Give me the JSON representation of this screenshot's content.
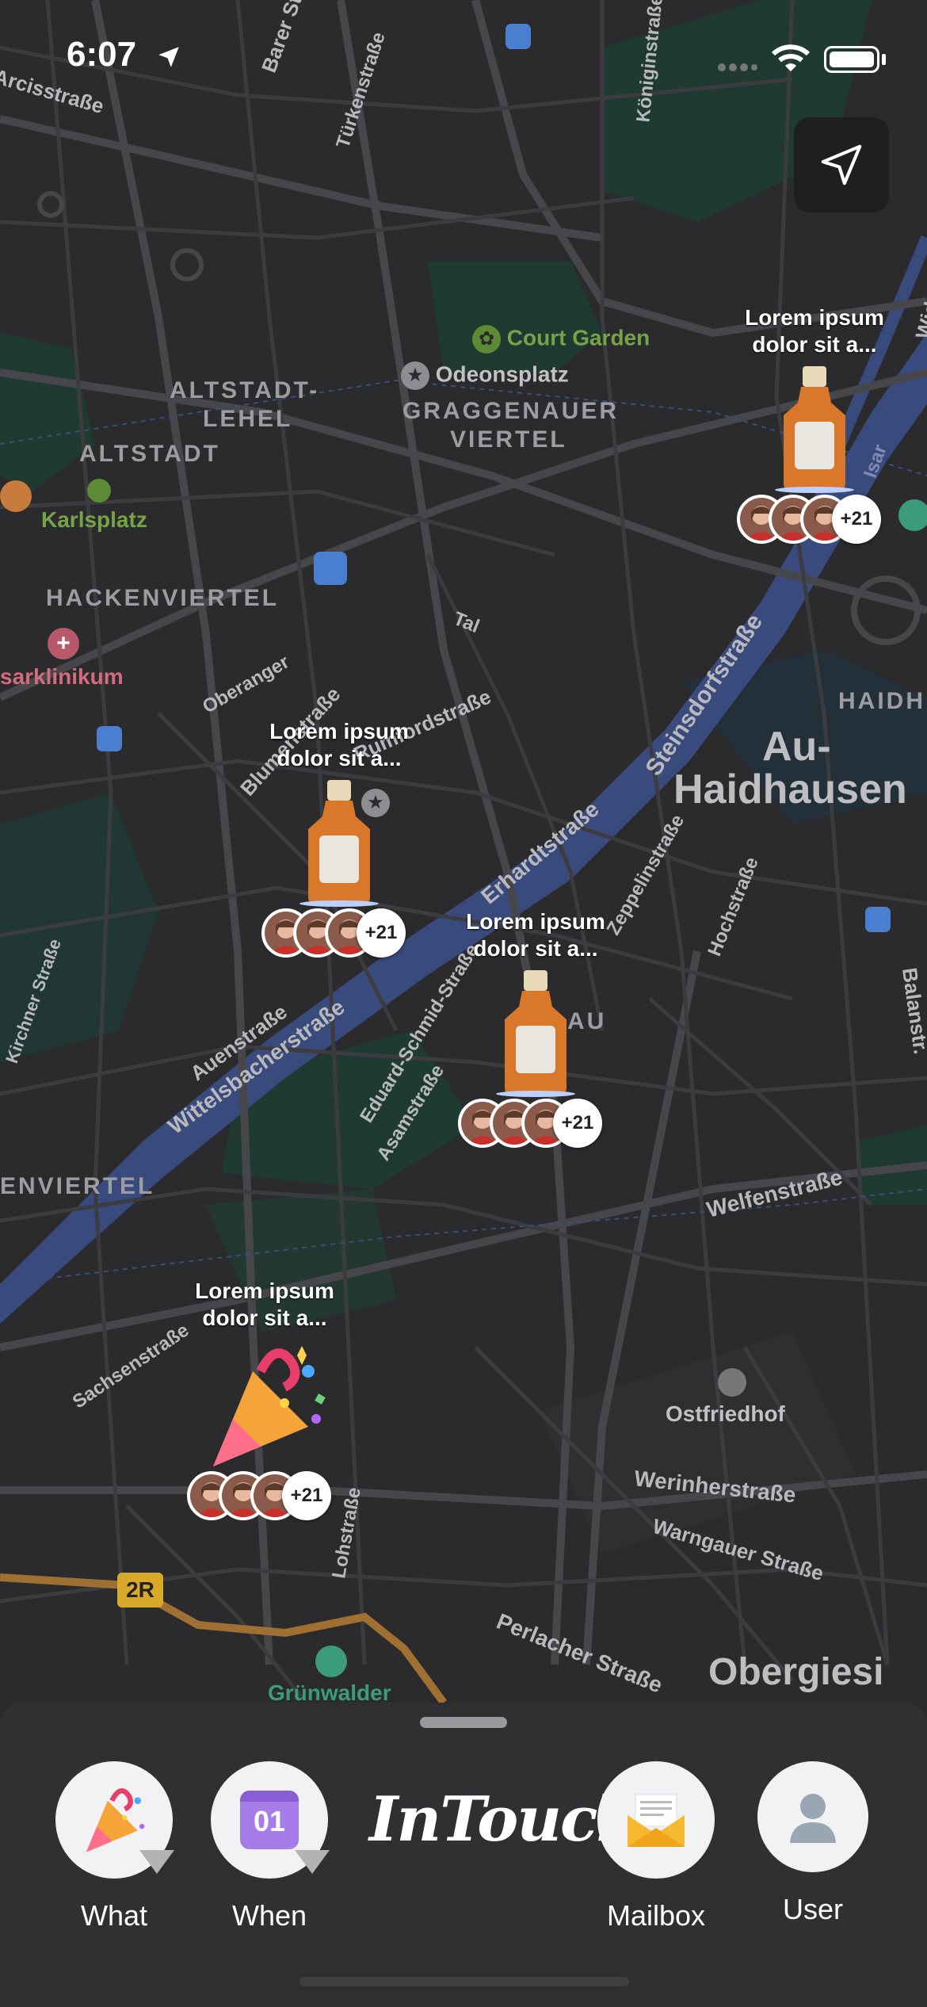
{
  "status_bar": {
    "time": "6:07"
  },
  "map": {
    "streets": [
      "Arcisstraße",
      "Barer Str.",
      "Türkenstraße",
      "Königinstraße",
      "Widenmayerstraße",
      "Steinsdorfstraße",
      "Erhardtstraße",
      "Zeppelinstraße",
      "Hochstraße",
      "Balanstr.",
      "Blumenstraße",
      "Oberanger",
      "Rumfordstraße",
      "Auenstraße",
      "Wittelsbacherstraße",
      "Eduard-Schmid-Straße",
      "Asamstraße",
      "Welfenstraße",
      "Werinherstraße",
      "Warngauer Straße",
      "Perlacher Straße",
      "Sachsenstraße",
      "Lohstraße",
      "Tal",
      "Isar",
      "Kirchner Straße"
    ],
    "districts": [
      "ALTSTADT-",
      "LEHEL",
      "ALTSTADT",
      "HACKENVIERTEL",
      "GRAGGENAUER",
      "VIERTEL",
      "HAIDH",
      "AU",
      "ENVIERTEL"
    ],
    "pois": [
      "Court Garden",
      "Odeonsplatz",
      "Karlsplatz",
      "sarklinikum",
      "Ostfriedhof",
      "Grünwalder"
    ],
    "city": [
      "Au-",
      "Haidhausen",
      "Obergiesi"
    ],
    "road_badge": "2R"
  },
  "pins": [
    {
      "title_line1": "Lorem ipsum",
      "title_line2": "dolor sit a...",
      "icon": "bottle-icon",
      "more": "+21"
    },
    {
      "title_line1": "Lorem ipsum",
      "title_line2": "dolor sit a...",
      "icon": "bottle-icon",
      "more": "+21"
    },
    {
      "title_line1": "Lorem ipsum",
      "title_line2": "dolor sit a...",
      "icon": "bottle-icon",
      "more": "+21"
    },
    {
      "title_line1": "Lorem ipsum",
      "title_line2": "dolor sit a...",
      "icon": "party-popper-icon",
      "more": "+21"
    }
  ],
  "bottom_bar": {
    "brand": "InTouch",
    "tabs": [
      {
        "label": "What",
        "icon": "party-popper-icon"
      },
      {
        "label": "When",
        "icon": "calendar-icon",
        "calendar_day": "01"
      },
      {
        "label": "Mailbox",
        "icon": "envelope-icon"
      },
      {
        "label": "User",
        "icon": "user-icon"
      }
    ]
  },
  "colors": {
    "map_bg": "#2b2b2d",
    "river": "#3a4a78",
    "park": "#1f3a32",
    "sheet": "#303032"
  }
}
